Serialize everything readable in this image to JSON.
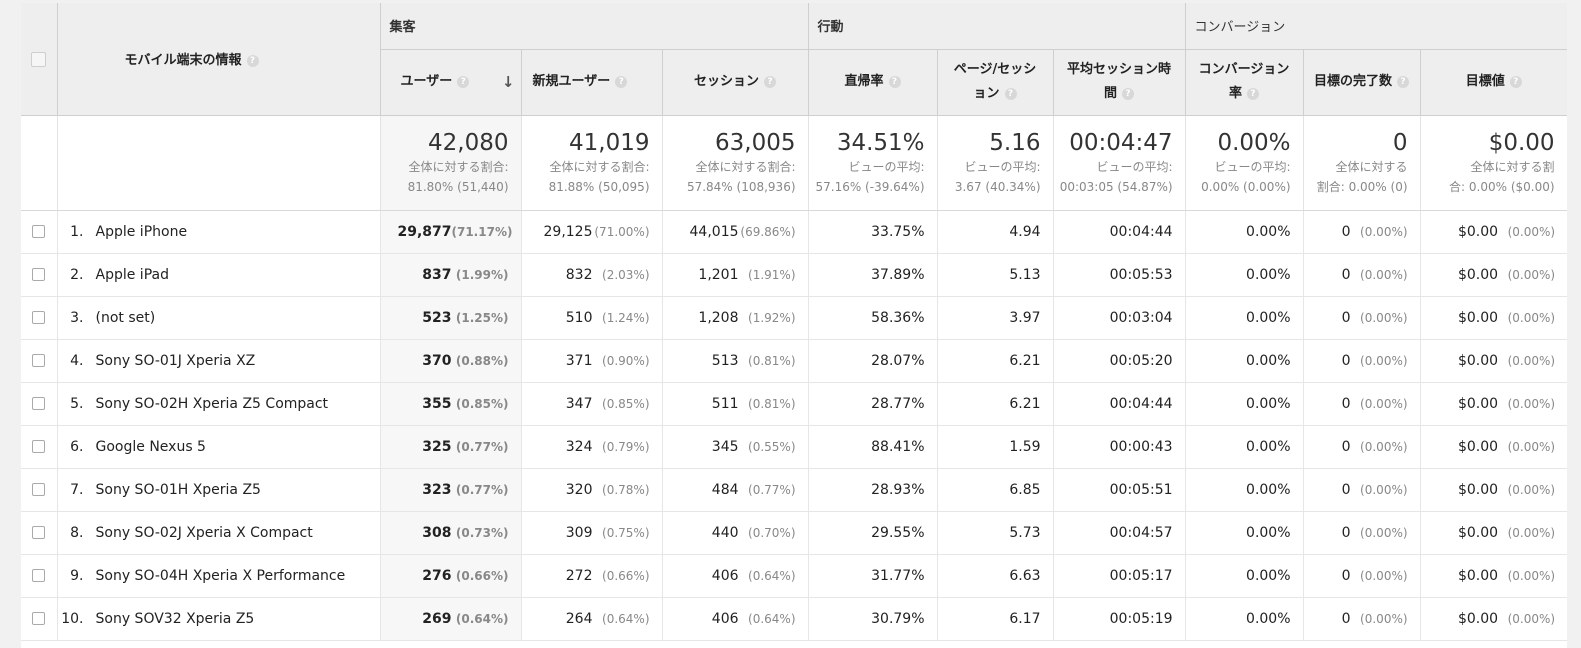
{
  "header": {
    "dimension": "モバイル端末の情報",
    "groups": {
      "acquisition": "集客",
      "behavior": "行動",
      "conversion": "コンバージョン"
    },
    "columns": [
      {
        "l1": "ユーザー",
        "l2": ""
      },
      {
        "l1": "新規ユーザー",
        "l2": ""
      },
      {
        "l1": "セッション",
        "l2": ""
      },
      {
        "l1": "直帰率",
        "l2": ""
      },
      {
        "l1": "ページ/セッシ",
        "l2": "ョン"
      },
      {
        "l1": "平均セッション時",
        "l2": "間"
      },
      {
        "l1": "コンバージョン",
        "l2": "率"
      },
      {
        "l1": "目標の完了数",
        "l2": ""
      },
      {
        "l1": "目標値",
        "l2": ""
      }
    ],
    "help_glyph": "?",
    "sort_glyph": "↓"
  },
  "summary": [
    {
      "value": "42,080",
      "s1": "全体に対する割合:",
      "s2": "81.80% (51,440)"
    },
    {
      "value": "41,019",
      "s1": "全体に対する割合:",
      "s2": "81.88% (50,095)"
    },
    {
      "value": "63,005",
      "s1": "全体に対する割合:",
      "s2": "57.84% (108,936)"
    },
    {
      "value": "34.51%",
      "s1": "ビューの平均:",
      "s2": "57.16% (-39.64%)"
    },
    {
      "value": "5.16",
      "s1": "ビューの平均:",
      "s2": "3.67 (40.34%)"
    },
    {
      "value": "00:04:47",
      "s1": "ビューの平均:",
      "s2": "00:03:05 (54.87%)"
    },
    {
      "value": "0.00%",
      "s1": "ビューの平均:",
      "s2": "0.00% (0.00%)"
    },
    {
      "value": "0",
      "s1": "全体に対する",
      "s2": "割合: 0.00% (0)"
    },
    {
      "value": "$0.00",
      "s1": "全体に対する割",
      "s2": "合: 0.00% ($0.00)"
    }
  ],
  "rows": [
    {
      "idx": "1.",
      "name": "Apple iPhone",
      "users": "29,877",
      "users_pct": "(71.17%)",
      "new": "29,125",
      "new_pct": "(71.00%)",
      "sess": "44,015",
      "sess_pct": "(69.86%)",
      "bounce": "33.75%",
      "pps": "4.94",
      "dur": "00:04:44",
      "cr": "0.00%",
      "goals": "0",
      "goals_pct": "(0.00%)",
      "gv": "$0.00",
      "gv_pct": "(0.00%)"
    },
    {
      "idx": "2.",
      "name": "Apple iPad",
      "users": "837",
      "users_pct": "(1.99%)",
      "new": "832",
      "new_pct": "(2.03%)",
      "sess": "1,201",
      "sess_pct": "(1.91%)",
      "bounce": "37.89%",
      "pps": "5.13",
      "dur": "00:05:53",
      "cr": "0.00%",
      "goals": "0",
      "goals_pct": "(0.00%)",
      "gv": "$0.00",
      "gv_pct": "(0.00%)"
    },
    {
      "idx": "3.",
      "name": "(not set)",
      "users": "523",
      "users_pct": "(1.25%)",
      "new": "510",
      "new_pct": "(1.24%)",
      "sess": "1,208",
      "sess_pct": "(1.92%)",
      "bounce": "58.36%",
      "pps": "3.97",
      "dur": "00:03:04",
      "cr": "0.00%",
      "goals": "0",
      "goals_pct": "(0.00%)",
      "gv": "$0.00",
      "gv_pct": "(0.00%)"
    },
    {
      "idx": "4.",
      "name": "Sony SO-01J Xperia XZ",
      "users": "370",
      "users_pct": "(0.88%)",
      "new": "371",
      "new_pct": "(0.90%)",
      "sess": "513",
      "sess_pct": "(0.81%)",
      "bounce": "28.07%",
      "pps": "6.21",
      "dur": "00:05:20",
      "cr": "0.00%",
      "goals": "0",
      "goals_pct": "(0.00%)",
      "gv": "$0.00",
      "gv_pct": "(0.00%)"
    },
    {
      "idx": "5.",
      "name": "Sony SO-02H Xperia Z5 Compact",
      "users": "355",
      "users_pct": "(0.85%)",
      "new": "347",
      "new_pct": "(0.85%)",
      "sess": "511",
      "sess_pct": "(0.81%)",
      "bounce": "28.77%",
      "pps": "6.21",
      "dur": "00:04:44",
      "cr": "0.00%",
      "goals": "0",
      "goals_pct": "(0.00%)",
      "gv": "$0.00",
      "gv_pct": "(0.00%)"
    },
    {
      "idx": "6.",
      "name": "Google Nexus 5",
      "users": "325",
      "users_pct": "(0.77%)",
      "new": "324",
      "new_pct": "(0.79%)",
      "sess": "345",
      "sess_pct": "(0.55%)",
      "bounce": "88.41%",
      "pps": "1.59",
      "dur": "00:00:43",
      "cr": "0.00%",
      "goals": "0",
      "goals_pct": "(0.00%)",
      "gv": "$0.00",
      "gv_pct": "(0.00%)"
    },
    {
      "idx": "7.",
      "name": "Sony SO-01H Xperia Z5",
      "users": "323",
      "users_pct": "(0.77%)",
      "new": "320",
      "new_pct": "(0.78%)",
      "sess": "484",
      "sess_pct": "(0.77%)",
      "bounce": "28.93%",
      "pps": "6.85",
      "dur": "00:05:51",
      "cr": "0.00%",
      "goals": "0",
      "goals_pct": "(0.00%)",
      "gv": "$0.00",
      "gv_pct": "(0.00%)"
    },
    {
      "idx": "8.",
      "name": "Sony SO-02J Xperia X Compact",
      "users": "308",
      "users_pct": "(0.73%)",
      "new": "309",
      "new_pct": "(0.75%)",
      "sess": "440",
      "sess_pct": "(0.70%)",
      "bounce": "29.55%",
      "pps": "5.73",
      "dur": "00:04:57",
      "cr": "0.00%",
      "goals": "0",
      "goals_pct": "(0.00%)",
      "gv": "$0.00",
      "gv_pct": "(0.00%)"
    },
    {
      "idx": "9.",
      "name": "Sony SO-04H Xperia X Performance",
      "users": "276",
      "users_pct": "(0.66%)",
      "new": "272",
      "new_pct": "(0.66%)",
      "sess": "406",
      "sess_pct": "(0.64%)",
      "bounce": "31.77%",
      "pps": "6.63",
      "dur": "00:05:17",
      "cr": "0.00%",
      "goals": "0",
      "goals_pct": "(0.00%)",
      "gv": "$0.00",
      "gv_pct": "(0.00%)"
    },
    {
      "idx": "10.",
      "name": "Sony SOV32 Xperia Z5",
      "users": "269",
      "users_pct": "(0.64%)",
      "new": "264",
      "new_pct": "(0.64%)",
      "sess": "406",
      "sess_pct": "(0.64%)",
      "bounce": "30.79%",
      "pps": "6.17",
      "dur": "00:05:19",
      "cr": "0.00%",
      "goals": "0",
      "goals_pct": "(0.00%)",
      "gv": "$0.00",
      "gv_pct": "(0.00%)"
    }
  ]
}
